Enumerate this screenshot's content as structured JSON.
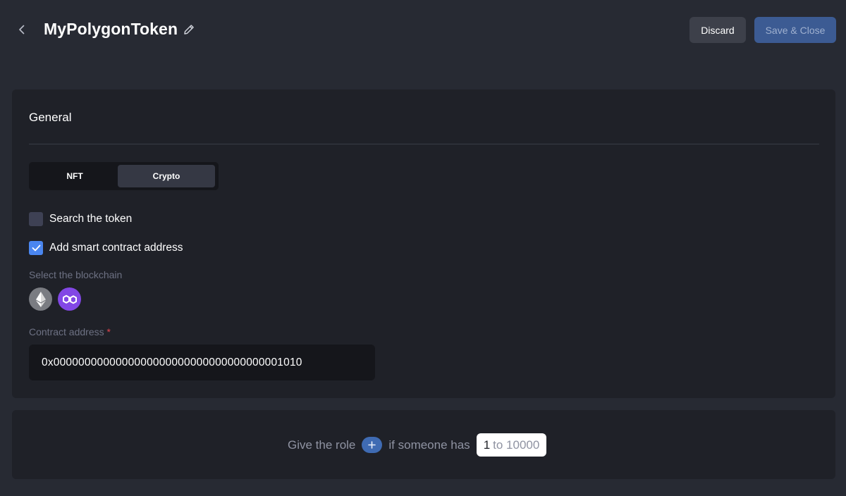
{
  "header": {
    "title": "MyPolygonToken",
    "discard_label": "Discard",
    "save_label": "Save & Close"
  },
  "general": {
    "title": "General",
    "tabs": [
      {
        "label": "NFT",
        "selected": false
      },
      {
        "label": "Crypto",
        "selected": true
      }
    ],
    "search_token": {
      "label": "Search the token",
      "checked": false
    },
    "add_contract": {
      "label": "Add smart contract address",
      "checked": true
    },
    "blockchain_label": "Select the blockchain",
    "blockchains": [
      "ethereum-icon",
      "polygon-icon"
    ],
    "contract_label": "Contract address",
    "required_mark": "*",
    "contract_value": "0x0000000000000000000000000000000000001010"
  },
  "role_rule": {
    "prefix": "Give the role",
    "middle": "if someone has",
    "range_min": "1",
    "range_rest": "to 10000"
  },
  "colors": {
    "background": "#272a33",
    "card": "#1f2128",
    "accent": "#4a86f0",
    "polygon": "#8247e5"
  }
}
